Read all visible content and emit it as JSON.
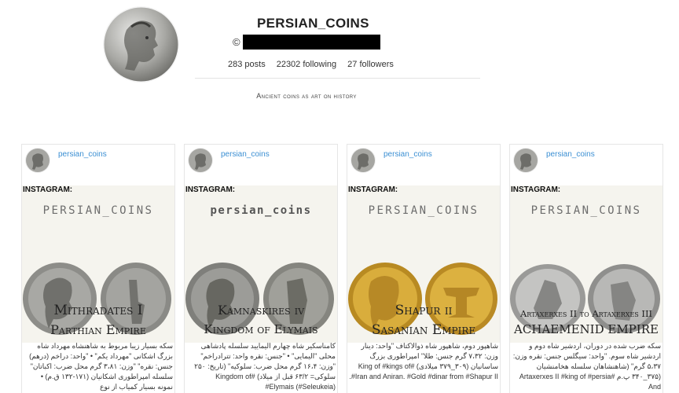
{
  "profile": {
    "username": "PERSIAN_COINS",
    "copyright_symbol": "©",
    "posts": "283 posts",
    "following": "22302 following",
    "followers": "27 followers",
    "bio": "Ancient coins as art on history"
  },
  "posts": [
    {
      "user": "persian_coins",
      "tag": "INSTAGRAM:",
      "brand": "PERSIAN_COINS",
      "title1": "Mithradates I",
      "title2": "Parthian Empire",
      "caption": "سکه بسیار زیبا مربوط به شاهنشاه مهرداد شاه بزرگ اشکانی \"مهرداد یکم\" • \"واحد: دراخم (درهم) جنس: نقره\" \"وزن: ۳،۸۱ گرم محل ضرب: اکباتان\" سلسله امپراطوری اشکانیان (۱۷۱-۱۳۲ ق.م) • نمونه بسیار کمیاب از نوع"
    },
    {
      "user": "persian_coins",
      "tag": "INSTAGRAM:",
      "brand": "persian_coins",
      "title1": "Kamnaskires iv",
      "title2": "Kingdom of Elymais",
      "caption": "کامناسکیر شاه چهارم الیمایید سلسله پادشاهی محلی \"الیمایی\" • \"جنس: نقره واحد: تترادراخم\" \"وزن: ۱۶،۴ گرم محل ضرب: سلوکیه\" (تاریخ: ۲۵۰ سلوکی= ۶۳/۲ قبل از میلاد) #Kingdom of #Elymais (#Seleukeia)"
    },
    {
      "user": "persian_coins",
      "tag": "INSTAGRAM:",
      "brand": "PERSIAN_COINS",
      "title1": "Shapur ii",
      "title2": "Sasanian Empire",
      "caption": "شاهپور دوم، شاهپور شاه ذوالاکتاف \"واحد: دینار وزن: ۷،۳۲ گرم جنس: طلا\" امپراطوری بزرگ ساسانیان (۳۰۹_۳۷۹ میلادی) #King of #kings of #Iran and Aniran. #Gold #dinar from #Shapur II."
    },
    {
      "user": "persian_coins",
      "tag": "INSTAGRAM:",
      "brand": "PERSIAN_COINS",
      "title1": "Artaxerxes II to Artaxerxes III",
      "title2": "ACHAEMENID EMPIRE",
      "caption": "سکه ضرب شده در دوران، اردشیر شاه دوم و اردشیر شاه سوم. \"واحد: سیگلس جنس: نقره وزن: ۵،۳۷ گرم\" (شاهنشاهان سلسله هخامنشیان (۳۷۵_۳۴۰ پ.م #Artaxerxes II #king of #persia And"
    }
  ],
  "colors": {
    "link": "#3b8fd3",
    "silver": "#9a9a96",
    "gold": "#d2a838"
  }
}
